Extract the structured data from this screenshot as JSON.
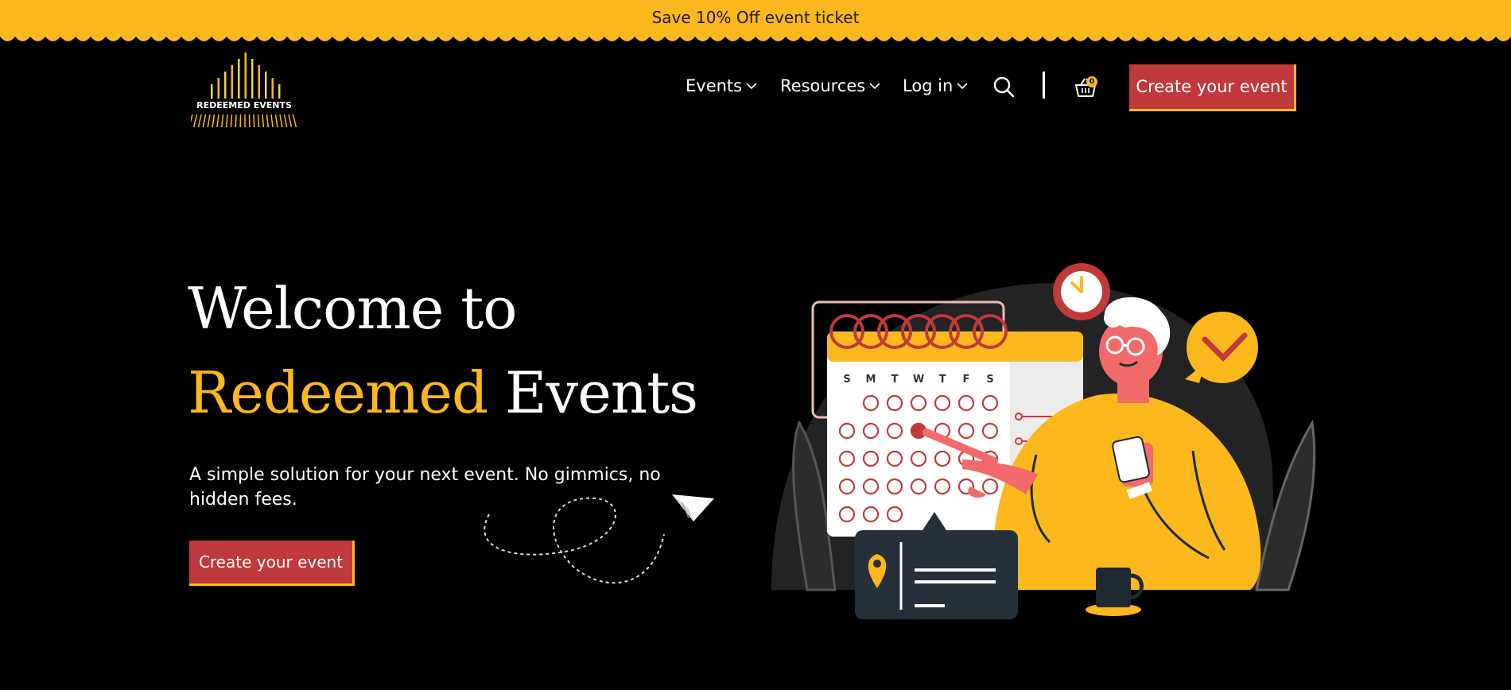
{
  "promo": {
    "text": "Save 10% Off event ticket"
  },
  "header": {
    "logo_text": "REDEEMED EVENTS",
    "nav": [
      {
        "label": "Events"
      },
      {
        "label": "Resources"
      },
      {
        "label": "Log in"
      }
    ],
    "cart_count": "0",
    "cta_label": "Create your event"
  },
  "hero": {
    "title_line1": "Welcome to",
    "title_accent": "Redeemed",
    "title_end": "Events",
    "subtitle": "A simple solution for your next event. No gimmics, no hidden fees.",
    "cta_label": "Create your event"
  },
  "calendar": {
    "weekdays": [
      "S",
      "M",
      "T",
      "W",
      "T",
      "F",
      "S"
    ]
  },
  "colors": {
    "brand_yellow": "#fcb81c",
    "brand_red": "#c0393b",
    "background": "#000000"
  }
}
